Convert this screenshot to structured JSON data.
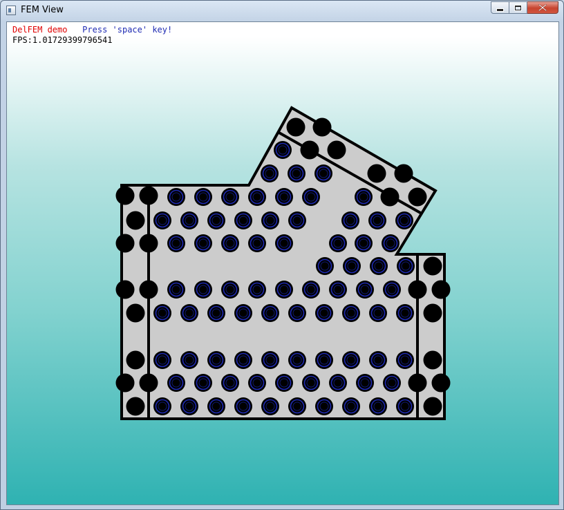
{
  "window": {
    "title": "FEM View",
    "icon": "app-window-icon",
    "controls": [
      "minimize",
      "maximize",
      "close"
    ]
  },
  "hud": {
    "demo_label": "DelFEM demo",
    "hint": "Press 'space' key!",
    "fps": "FPS:1.01729399796541"
  },
  "colors": {
    "background_top": "#ffffff",
    "background_bottom": "#2fb2b2",
    "mesh_fill": "#cccccc",
    "outline": "#000000",
    "particle": "#000000",
    "particle_ring": "#1f2bb3",
    "demo_label": "#e00000",
    "hint": "#1f2bb3"
  }
}
